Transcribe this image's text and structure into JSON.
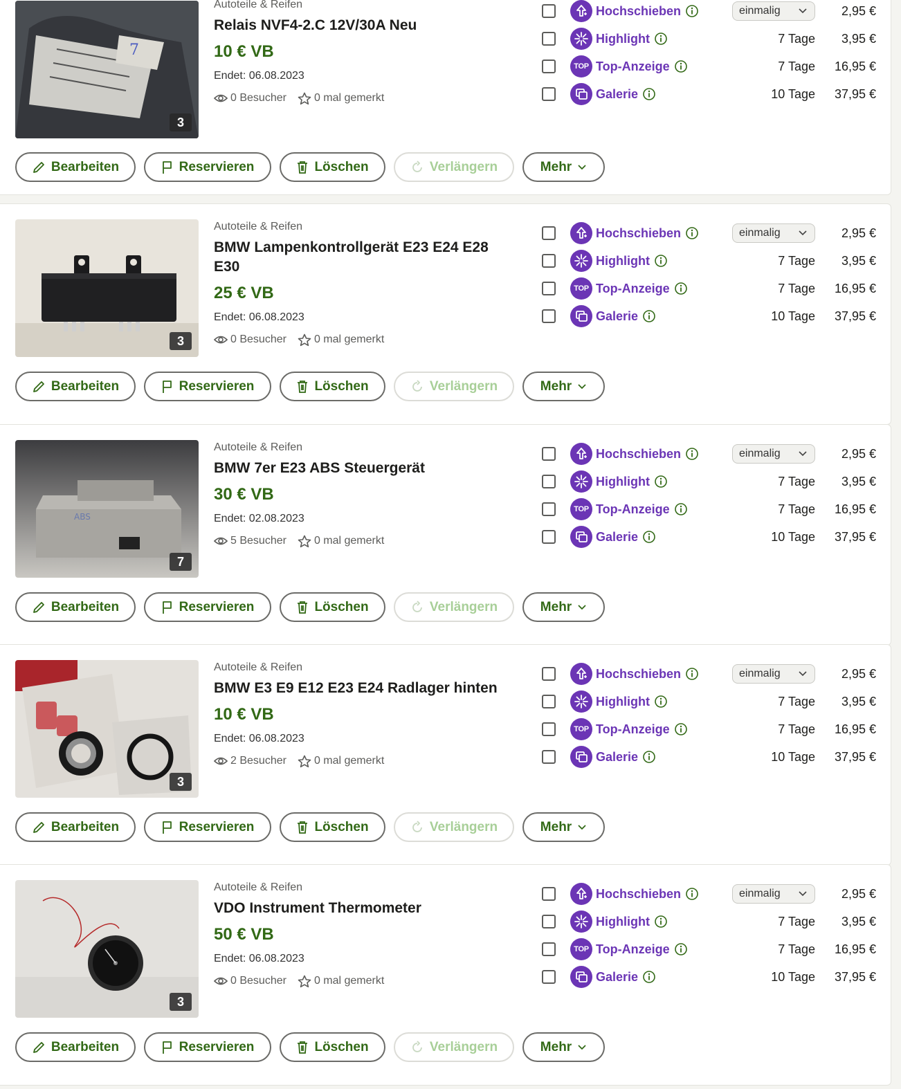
{
  "colors": {
    "price_green": "#326916",
    "feature_purple": "#6b35b5",
    "disabled_green": "#a8cf98"
  },
  "features": [
    {
      "name": "Hochschieben",
      "icon": "arrow-up-icon",
      "duration": "",
      "fee": "2,95 €",
      "select": "einmalig"
    },
    {
      "name": "Highlight",
      "icon": "sparkle-icon",
      "duration": "7 Tage",
      "fee": "3,95 €"
    },
    {
      "name": "Top-Anzeige",
      "icon": "top-badge-icon",
      "icon_text": "TOP",
      "duration": "7 Tage",
      "fee": "16,95 €"
    },
    {
      "name": "Galerie",
      "icon": "gallery-icon",
      "duration": "10 Tage",
      "fee": "37,95 €"
    }
  ],
  "actions": {
    "edit": "Bearbeiten",
    "reserve": "Reservieren",
    "delete": "Löschen",
    "extend": "Verlängern",
    "more": "Mehr"
  },
  "listings": [
    {
      "category": "Autoteile & Reifen",
      "title": "Relais NVF4-2.C 12V/30A Neu",
      "price": "10 € VB",
      "ends": "Endet: 06.08.2023",
      "visitors": "0 Besucher",
      "watched": "0 mal gemerkt",
      "image_count": "3",
      "image": "relay-bag-photo"
    },
    {
      "category": "Autoteile & Reifen",
      "title": "BMW Lampenkontrollgerät E23 E24 E28 E30",
      "price": "25 € VB",
      "ends": "Endet: 06.08.2023",
      "visitors": "0 Besucher",
      "watched": "0 mal gemerkt",
      "image_count": "3",
      "image": "black-control-unit-photo"
    },
    {
      "category": "Autoteile & Reifen",
      "title": "BMW 7er E23 ABS Steuergerät",
      "price": "30 € VB",
      "ends": "Endet: 02.08.2023",
      "visitors": "5 Besucher",
      "watched": "0 mal gemerkt",
      "image_count": "7",
      "image": "abs-control-unit-photo"
    },
    {
      "category": "Autoteile & Reifen",
      "title": "BMW E3 E9 E12 E23 E24 Radlager hinten",
      "price": "10 € VB",
      "ends": "Endet: 06.08.2023",
      "visitors": "2 Besucher",
      "watched": "0 mal gemerkt",
      "image_count": "3",
      "image": "wheel-bearing-photo"
    },
    {
      "category": "Autoteile & Reifen",
      "title": "VDO Instrument Thermometer",
      "price": "50 € VB",
      "ends": "Endet: 06.08.2023",
      "visitors": "0 Besucher",
      "watched": "0 mal gemerkt",
      "image_count": "3",
      "image": "thermometer-gauge-photo"
    }
  ]
}
